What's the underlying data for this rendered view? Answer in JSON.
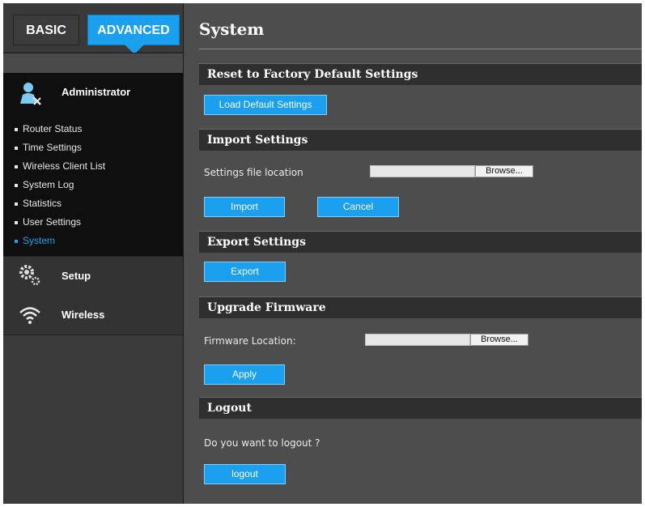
{
  "tabs": {
    "basic": "BASIC",
    "advanced": "ADVANCED"
  },
  "sidebar": {
    "administrator": {
      "title": "Administrator",
      "items": [
        "Router Status",
        "Time Settings",
        "Wireless Client List",
        "System Log",
        "Statistics",
        "User Settings",
        "System"
      ],
      "active_item": "System"
    },
    "setup": {
      "title": "Setup"
    },
    "wireless": {
      "title": "Wireless"
    }
  },
  "main": {
    "title": "System",
    "reset": {
      "heading": "Reset to Factory Default Settings",
      "button": "Load Default Settings"
    },
    "import": {
      "heading": "Import Settings",
      "file_label": "Settings file location",
      "browse": "Browse...",
      "import_button": "Import",
      "cancel_button": "Cancel"
    },
    "export": {
      "heading": "Export Settings",
      "button": "Export"
    },
    "firmware": {
      "heading": "Upgrade Firmware",
      "file_label": "Firmware Location:",
      "browse": "Browse...",
      "button": "Apply"
    },
    "logout": {
      "heading": "Logout",
      "prompt": "Do you want to logout ?",
      "button": "logout"
    }
  },
  "colors": {
    "accent": "#1aa0ee",
    "background": "#4d4d4d",
    "sidebar": "#2e2e2e"
  },
  "icons": {
    "administrator": "admin-tools-icon",
    "setup": "gears-icon",
    "wireless": "wifi-icon"
  }
}
